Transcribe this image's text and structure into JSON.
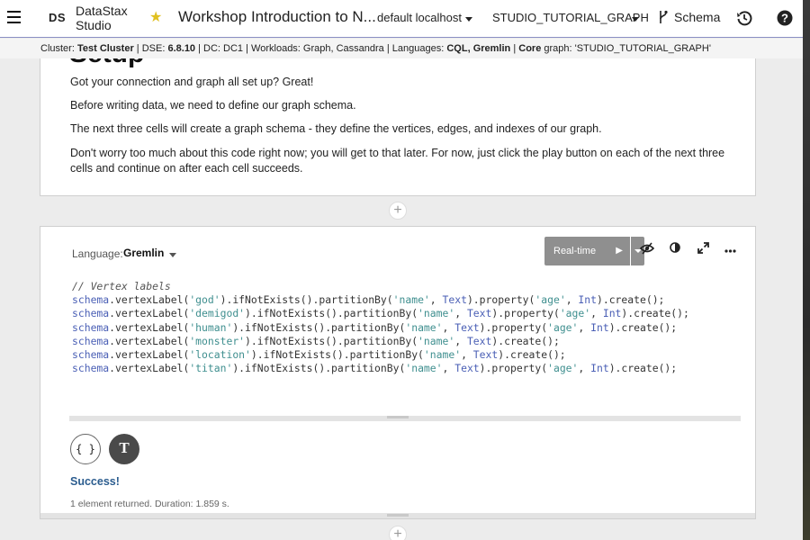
{
  "topbar": {
    "logo": "DS",
    "brand_line1": "DataStax",
    "brand_line2": "Studio",
    "notebook_title": "Workshop Introduction to N...",
    "connection": "default localhost",
    "graph": "STUDIO_TUTORIAL_GRAPH",
    "schema_label": "Schema"
  },
  "statusbar": {
    "cluster_label": "Cluster:",
    "cluster": "Test Cluster",
    "dse_label": "DSE:",
    "dse": "6.8.10",
    "dc": "DC: DC1",
    "workloads": "Workloads: Graph, Cassandra",
    "languages_label": "Languages:",
    "languages": "CQL, Gremlin",
    "core_label": "Core",
    "core_graph": "graph: 'STUDIO_TUTORIAL_GRAPH'"
  },
  "markdown_cell": {
    "heading": "Setup",
    "paragraphs": [
      "Got your connection and graph all set up? Great!",
      "Before writing data, we need to define our graph schema.",
      "The next three cells will create a graph schema - they define the vertices, edges, and indexes of our graph.",
      "Don't worry too much about this code right now; you will get to that later. For now, just click the play button on each of the next three cells and continue on after each cell succeeds."
    ]
  },
  "add_cell": "+",
  "code_cell": {
    "language_label": "Language:",
    "language": "Gremlin",
    "run_mode": "Real-time",
    "comment": "// Vertex labels",
    "lines": [
      {
        "label": "'god'",
        "partition": "'name'",
        "ptype": "Text",
        "property": "'age'",
        "type": "Int",
        "method": "ifNotExists"
      },
      {
        "label": "'demigod'",
        "partition": "'name'",
        "ptype": "Text",
        "property": "'age'",
        "type": "Int",
        "method": "ifNotExists"
      },
      {
        "label": "'human'",
        "partition": "'name'",
        "ptype": "Text",
        "property": "'age'",
        "type": "Int",
        "method": "ifNotExists"
      },
      {
        "label": "'monster'",
        "partition": "'name'",
        "ptype": "Text",
        "property": "",
        "type": "",
        "method": "ifNotExists"
      },
      {
        "label": "'location'",
        "partition": "'name'",
        "ptype": "Text",
        "property": "",
        "type": "",
        "method": "ifNotExists"
      },
      {
        "label": "'titan'",
        "partition": "'name'",
        "ptype": "Text",
        "property": "'age'",
        "type": "Int",
        "method": "ifNotExists"
      }
    ],
    "result_view_json": "{ }",
    "result_view_text": "T",
    "status": "Success!",
    "result_meta": "1 element returned. Duration: 1.859 s."
  }
}
